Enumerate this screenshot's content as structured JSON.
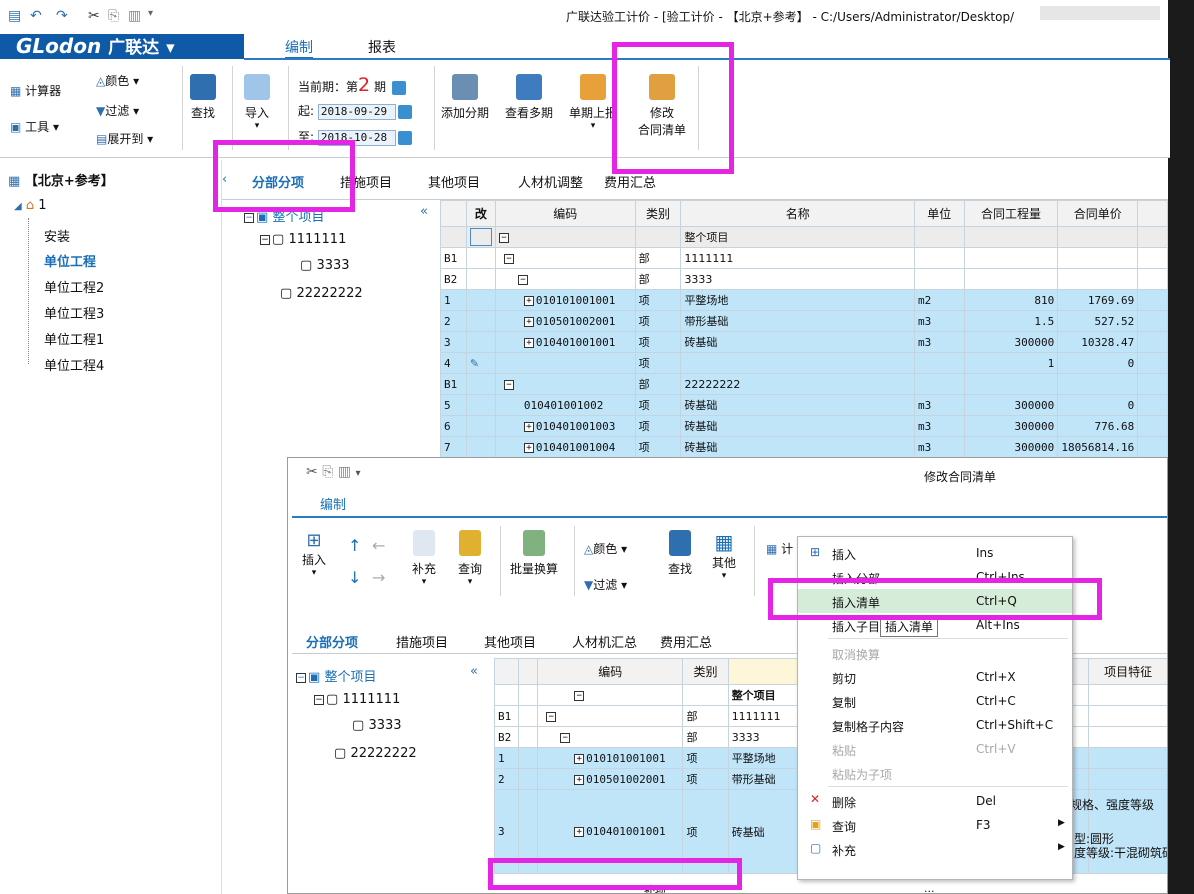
{
  "window": {
    "title": "广联达验工计价 - [验工计价 - 【北京+参考】 - C:/Users/Administrator/Desktop/"
  },
  "brand": {
    "logo": "GLodon",
    "name": "广联达"
  },
  "menu_tabs": [
    "编制",
    "报表"
  ],
  "ribbon": {
    "calculator": "计算器",
    "color": "颜色",
    "filter": "过滤",
    "tools": "工具",
    "expand": "展开到",
    "find": "查找",
    "import": "导入",
    "period_prefix": "当前期：第",
    "period_num": "2",
    "period_suffix": "期",
    "start_label": "起:",
    "start_date": "2018-09-29",
    "end_label": "至:",
    "end_date": "2018-10-28",
    "add_period": "添加分期",
    "view_periods": "查看多期",
    "upload": "单期上报",
    "modify_1": "修改",
    "modify_2": "合同清单"
  },
  "left_tree": {
    "root": "【北京+参考】",
    "project": "1",
    "items": [
      "安装",
      "单位工程",
      "单位工程2",
      "单位工程3",
      "单位工程1",
      "单位工程4"
    ]
  },
  "tabs": [
    "分部分项",
    "措施项目",
    "其他项目",
    "人材机调整",
    "费用汇总"
  ],
  "sub_tree": {
    "root": "整个项目",
    "n1": "1111111",
    "n2": "3333",
    "n3": "22222222"
  },
  "grid": {
    "headers": [
      "改",
      "编码",
      "类别",
      "名称",
      "单位",
      "合同工程量",
      "合同单价"
    ],
    "rows": [
      {
        "seq": "",
        "code": "",
        "cat": "",
        "name": "整个项目",
        "unit": "",
        "qty": "",
        "price": ""
      },
      {
        "seq": "B1",
        "code": "",
        "cat": "部",
        "name": "1111111",
        "unit": "",
        "qty": "",
        "price": ""
      },
      {
        "seq": "B2",
        "code": "",
        "cat": "部",
        "name": "3333",
        "unit": "",
        "qty": "",
        "price": ""
      },
      {
        "seq": "1",
        "code": "010101001001",
        "cat": "项",
        "name": "平整场地",
        "unit": "m2",
        "qty": "810",
        "price": "1769.69"
      },
      {
        "seq": "2",
        "code": "010501002001",
        "cat": "项",
        "name": "带形基础",
        "unit": "m3",
        "qty": "1.5",
        "price": "527.52"
      },
      {
        "seq": "3",
        "code": "010401001001",
        "cat": "项",
        "name": "砖基础",
        "unit": "m3",
        "qty": "300000",
        "price": "10328.47"
      },
      {
        "seq": "4",
        "code": "",
        "cat": "项",
        "name": "",
        "unit": "",
        "qty": "1",
        "price": "0"
      },
      {
        "seq": "B1",
        "code": "",
        "cat": "部",
        "name": "22222222",
        "unit": "",
        "qty": "",
        "price": ""
      },
      {
        "seq": "5",
        "code": "010401001002",
        "cat": "项",
        "name": "砖基础",
        "unit": "m3",
        "qty": "300000",
        "price": "0"
      },
      {
        "seq": "6",
        "code": "010401001003",
        "cat": "项",
        "name": "砖基础",
        "unit": "m3",
        "qty": "300000",
        "price": "776.68"
      },
      {
        "seq": "7",
        "code": "010401001004",
        "cat": "项",
        "name": "砖基础",
        "unit": "m3",
        "qty": "300000",
        "price": "18056814.16"
      }
    ]
  },
  "dialog": {
    "title": "修改合同清单",
    "menu_tab": "编制",
    "toolbar": {
      "insert": "插入",
      "supplement": "补充",
      "query": "查询",
      "batch": "批量换算",
      "color": "颜色",
      "filter": "过滤",
      "find": "查找",
      "other": "其他",
      "calc": "计"
    },
    "tabs": [
      "分部分项",
      "措施项目",
      "其他项目",
      "人材机汇总",
      "费用汇总"
    ],
    "tree": {
      "root": "整个项目",
      "n1": "1111111",
      "n2": "3333",
      "n3": "22222222"
    },
    "headers": [
      "编码",
      "类别",
      "项目特征"
    ],
    "rows": [
      {
        "seq": "",
        "code": "",
        "cat": "",
        "name": "整个项目"
      },
      {
        "seq": "B1",
        "code": "",
        "cat": "部",
        "name": "1111111"
      },
      {
        "seq": "B2",
        "code": "",
        "cat": "部",
        "name": "3333"
      },
      {
        "seq": "1",
        "code": "010101001001",
        "cat": "项",
        "name": "平整场地"
      },
      {
        "seq": "2",
        "code": "010501002001",
        "cat": "项",
        "name": "带形基础"
      },
      {
        "seq": "3",
        "code": "010401001001",
        "cat": "项",
        "name": "砖基础"
      }
    ],
    "feature_1": "、规格、强度等级",
    "feature_2": "型:圆形",
    "feature_3": "度等级:干混砌筑砂",
    "bottom_cat": "补项",
    "bottom_more": "..."
  },
  "context_menu": [
    {
      "label": "插入",
      "shortcut": "Ins"
    },
    {
      "label": "插入分部",
      "shortcut": "Ctrl+Ins"
    },
    {
      "label": "插入清单",
      "shortcut": "Ctrl+Q"
    },
    {
      "label": "插入子目",
      "shortcut": "Alt+Ins"
    },
    {
      "label": "取消换算",
      "shortcut": ""
    },
    {
      "label": "剪切",
      "shortcut": "Ctrl+X"
    },
    {
      "label": "复制",
      "shortcut": "Ctrl+C"
    },
    {
      "label": "复制格子内容",
      "shortcut": "Ctrl+Shift+C"
    },
    {
      "label": "粘贴",
      "shortcut": "Ctrl+V"
    },
    {
      "label": "粘贴为子项",
      "shortcut": ""
    },
    {
      "label": "删除",
      "shortcut": "Del"
    },
    {
      "label": "查询",
      "shortcut": "F3"
    },
    {
      "label": "补充",
      "shortcut": ""
    }
  ],
  "tooltip": "插入清单",
  "colors": {
    "brand": "#0e5aa7",
    "accent": "#1a6fb8",
    "row_blue": "#c0e4f8",
    "highlight": "#e426e4"
  }
}
